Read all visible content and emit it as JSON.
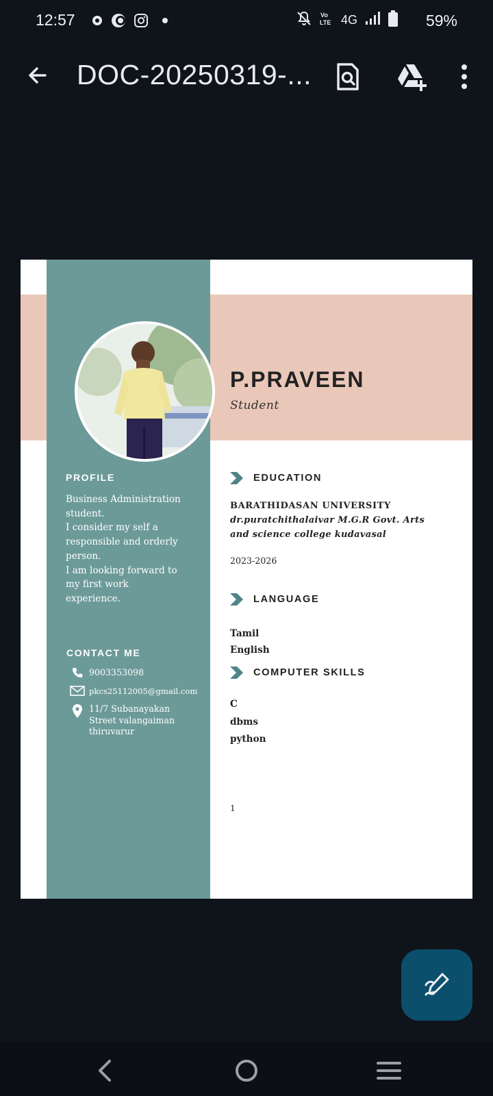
{
  "status_bar": {
    "time": "12:57",
    "network": "4G",
    "battery": "59%",
    "icons": [
      "app-notification-icon",
      "moon-icon",
      "instagram-icon",
      "dot-icon",
      "mute-bell-icon",
      "volte-icon",
      "signal-icon",
      "battery-icon"
    ]
  },
  "app_bar": {
    "title": "DOC-20250319-...",
    "icons": [
      "back-arrow-icon",
      "search-doc-icon",
      "drive-add-icon",
      "more-vert-icon"
    ]
  },
  "resume": {
    "name": "P.PRAVEEN",
    "role": "Student",
    "profile_heading": "PROFILE",
    "profile_lines": [
      "Business Administration",
      "student.",
      "I consider my self a",
      "responsible and orderly",
      "person.",
      "I am looking forward to",
      "my first work",
      "experience."
    ],
    "contact_heading": "CONTACT ME",
    "phone": "9003353098",
    "email": "pkcs25112005@gmail.com",
    "address_lines": [
      "11/7 Subanayakan",
      "Street valangaiman",
      "thiruvarur"
    ],
    "education_heading": "EDUCATION",
    "university": "BARATHIDASAN UNIVERSITY",
    "college_lines": [
      "dr.puratchithalaivar M.G.R Govt. Arts",
      "and science college kudavasal"
    ],
    "years": "2023-2026",
    "language_heading": "LANGUAGE",
    "languages": [
      "Tamil",
      "English"
    ],
    "skills_heading": "COMPUTER SKILLS",
    "skills": [
      "C",
      "dbms",
      "python"
    ],
    "page_number": "1"
  },
  "colors": {
    "background": "#0f141b",
    "teal": "#6c9a99",
    "peach": "#eac8b9",
    "fab": "#0b4f6c"
  }
}
